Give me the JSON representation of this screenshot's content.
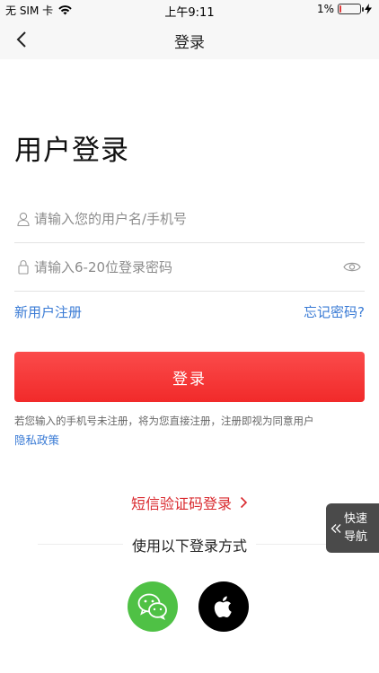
{
  "status_bar": {
    "carrier": "无 SIM 卡",
    "time": "上午9:11",
    "battery_percent": "1%",
    "battery_level": 0.03
  },
  "nav": {
    "title": "登录",
    "back_icon": "chevron-left-icon"
  },
  "page_title": "用户登录",
  "username_field": {
    "placeholder": "请输入您的用户名/手机号",
    "value": "",
    "icon": "person-icon"
  },
  "password_field": {
    "placeholder": "请输入6-20位登录密码",
    "value": "",
    "icon": "lock-icon",
    "toggle_icon": "eye-icon"
  },
  "links": {
    "register": "新用户注册",
    "forgot_password": "忘记密码?"
  },
  "login_button": "登录",
  "notice": "若您输入的手机号未注册，将为您直接注册，注册即视为同意用户",
  "privacy_policy": "隐私政策",
  "sms_login": "短信验证码登录",
  "other_methods_title": "使用以下登录方式",
  "social_logins": [
    {
      "icon": "wechat-icon",
      "color": "#4fc145"
    },
    {
      "icon": "apple-icon",
      "color": "#000000"
    }
  ],
  "quick_nav": {
    "line1": "快速",
    "line2": "导航"
  },
  "colors": {
    "accent_red": "#f12a2a",
    "link_blue": "#3a7bd5"
  }
}
